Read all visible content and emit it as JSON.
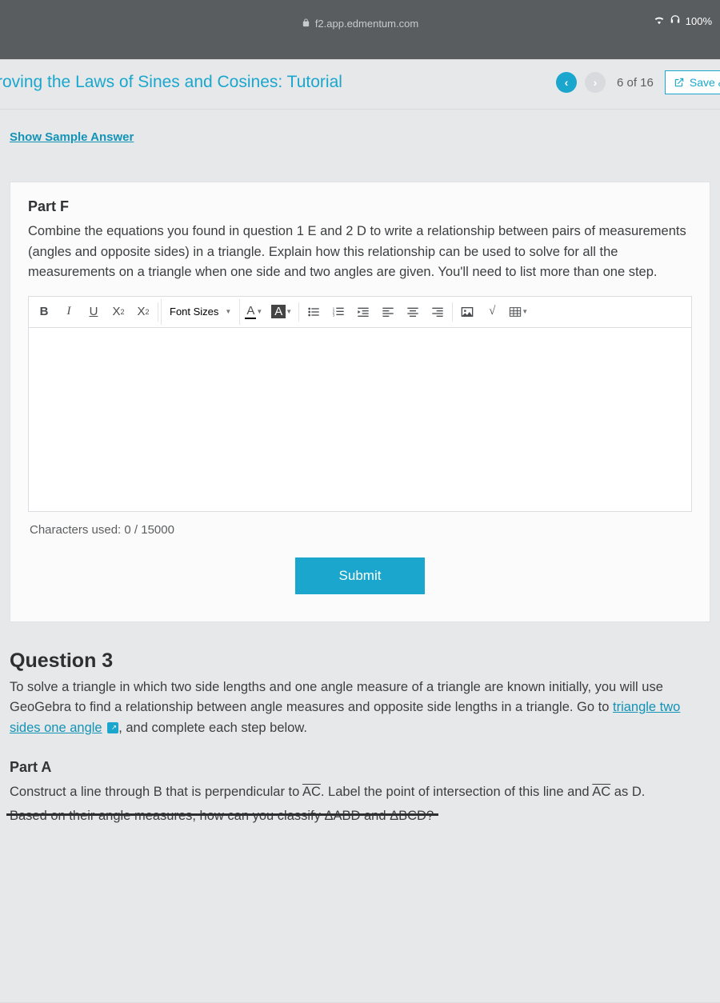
{
  "status": {
    "battery": "100%",
    "signal_icon": "wifi-headphones"
  },
  "url": "f2.app.edmentum.com",
  "header": {
    "title": "Proving the Laws of Sines and Cosines: Tutorial",
    "counter": "6 of 16",
    "save_label": "Save &"
  },
  "sample_link": "Show Sample Answer",
  "partF": {
    "title": "Part F",
    "desc": "Combine the equations you found in question 1 E and 2 D to write a relationship between pairs of measurements (angles and opposite sides) in a triangle. Explain how this relationship can be used to solve for all the measurements on a triangle when one side and two angles are given. You'll need to list more than one step."
  },
  "toolbar": {
    "bold": "B",
    "italic": "I",
    "underline": "U",
    "sup": "X",
    "sub": "X",
    "font_sizes": "Font Sizes",
    "textcolor": "A",
    "bgcolor": "A"
  },
  "char_count": "Characters used: 0 / 15000",
  "submit": "Submit",
  "q3": {
    "title": "Question 3",
    "text_a": "To solve a triangle in which two side lengths and one angle measure of a triangle are known initially, you will use GeoGebra to find a relationship between angle measures and opposite side lengths in a triangle. Go to ",
    "link": "triangle two sides one angle",
    "text_b": ", and complete each step below."
  },
  "partA": {
    "title": "Part A",
    "text_a": "Construct a line through B that is perpendicular to ",
    "seg1": "AC",
    "text_b": ". Label the point of intersection of this line and ",
    "seg2": "AC",
    "text_c": " as D.",
    "cutoff": "Based on their angle measures, how can you classify ΔABD and ΔBCD?"
  }
}
